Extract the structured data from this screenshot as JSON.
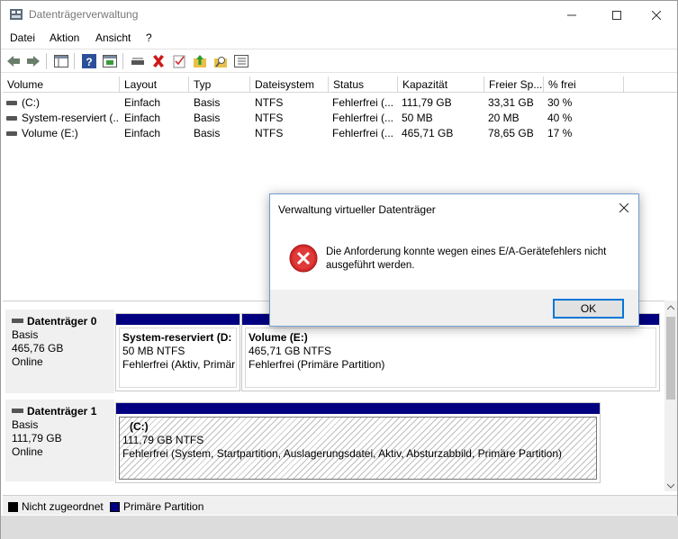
{
  "window": {
    "title": "Datenträgerverwaltung"
  },
  "menu": [
    "Datei",
    "Aktion",
    "Ansicht",
    "?"
  ],
  "list": {
    "columns": [
      "Volume",
      "Layout",
      "Typ",
      "Dateisystem",
      "Status",
      "Kapazität",
      "Freier Sp...",
      "% frei"
    ],
    "rows": [
      [
        "(C:)",
        "Einfach",
        "Basis",
        "NTFS",
        "Fehlerfrei (...",
        "111,79 GB",
        "33,31 GB",
        "30 %"
      ],
      [
        "System-reserviert (...",
        "Einfach",
        "Basis",
        "NTFS",
        "Fehlerfrei (...",
        "50 MB",
        "20 MB",
        "40 %"
      ],
      [
        "Volume (E:)",
        "Einfach",
        "Basis",
        "NTFS",
        "Fehlerfrei (...",
        "465,71 GB",
        "78,65 GB",
        "17 %"
      ]
    ]
  },
  "disks": [
    {
      "name": "Datenträger 0",
      "type": "Basis",
      "size": "465,76 GB",
      "state": "Online",
      "partitions": [
        {
          "name": "System-reserviert  (D:",
          "size": "50 MB NTFS",
          "status": "Fehlerfrei (Aktiv, Primär"
        },
        {
          "name": "Volume  (E:)",
          "size": "465,71 GB NTFS",
          "status": "Fehlerfrei (Primäre Partition)"
        }
      ]
    },
    {
      "name": "Datenträger 1",
      "type": "Basis",
      "size": "111,79 GB",
      "state": "Online",
      "partitions": [
        {
          "name": "(C:)",
          "size": "111,79 GB NTFS",
          "status": "Fehlerfrei (System, Startpartition, Auslagerungsdatei, Aktiv, Absturzabbild, Primäre Partition)"
        }
      ]
    }
  ],
  "legend": [
    {
      "label": "Nicht zugeordnet",
      "color": "#000000"
    },
    {
      "label": "Primäre Partition",
      "color": "#000080"
    }
  ],
  "dialog": {
    "title": "Verwaltung virtueller Datenträger",
    "message": "Die Anforderung konnte wegen eines E/A-Gerätefehlers nicht ausgeführt werden.",
    "ok_label": "OK"
  },
  "colors": {
    "partition_bar": "#000080",
    "error_red": "#d42a2a",
    "focus_blue": "#0078d7"
  }
}
